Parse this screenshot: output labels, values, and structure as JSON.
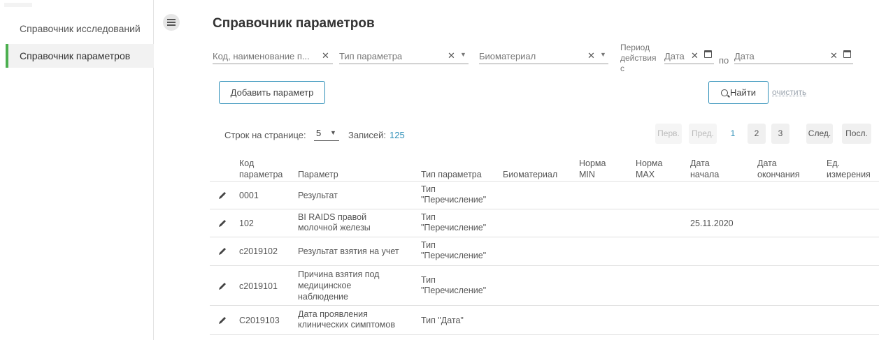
{
  "sidebar": {
    "items": [
      {
        "label": "Справочник исследований"
      },
      {
        "label": "Справочник параметров"
      }
    ]
  },
  "page": {
    "title": "Справочник параметров"
  },
  "filters": {
    "code_placeholder": "Код, наименование п...",
    "type_placeholder": "Тип параметра",
    "biomaterial_placeholder": "Биоматериал",
    "period_label_1": "Период",
    "period_label_2": "действия",
    "period_label_3": "с",
    "date_from_placeholder": "Дата",
    "po_label": "по",
    "date_to_placeholder": "Дата"
  },
  "toolbar": {
    "add_label": "Добавить параметр",
    "find_label": "Найти",
    "clear_label": "очистить"
  },
  "pagination": {
    "rows_label": "Строк на странице:",
    "rows_value": "5",
    "count_label": "Записей:",
    "count_value": "125",
    "first": "Перв.",
    "prev": "Пред.",
    "pages": [
      "1",
      "2",
      "3"
    ],
    "next": "След.",
    "last": "Посл."
  },
  "table": {
    "headers": {
      "code_1": "Код",
      "code_2": "параметра",
      "param": "Параметр",
      "type": "Тип параметра",
      "bio": "Биоматериал",
      "min_1": "Норма",
      "min_2": "MIN",
      "max_1": "Норма",
      "max_2": "MAX",
      "start_1": "Дата",
      "start_2": "начала",
      "end_1": "Дата",
      "end_2": "окончания",
      "unit_1": "Ед.",
      "unit_2": "измерения"
    },
    "rows": [
      {
        "code": "0001",
        "param_1": "Результат",
        "param_2": "",
        "param_3": "",
        "type_1": "Тип",
        "type_2": "\"Перечисление\"",
        "start": ""
      },
      {
        "code": "102",
        "param_1": "BI RAIDS правой",
        "param_2": "молочной железы",
        "param_3": "",
        "type_1": "Тип",
        "type_2": "\"Перечисление\"",
        "start": "25.11.2020"
      },
      {
        "code": "c2019102",
        "param_1": "Результат взятия на учет",
        "param_2": "",
        "param_3": "",
        "type_1": "Тип",
        "type_2": "\"Перечисление\"",
        "start": ""
      },
      {
        "code": "c2019101",
        "param_1": "Причина взятия под",
        "param_2": "медицинское",
        "param_3": "наблюдение",
        "type_1": "Тип",
        "type_2": "\"Перечисление\"",
        "start": ""
      },
      {
        "code": "C2019103",
        "param_1": "Дата проявления",
        "param_2": "клинических симптомов",
        "param_3": "",
        "type_1": "Тип \"Дата\"",
        "type_2": "",
        "start": ""
      }
    ]
  },
  "colors": {
    "accent": "#2e8fb8",
    "active_marker": "#4caf50"
  }
}
